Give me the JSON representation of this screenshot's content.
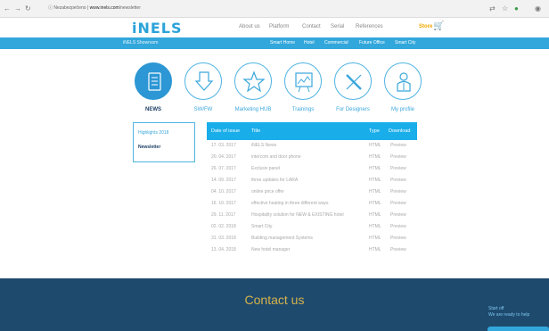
{
  "browser": {
    "url_prefix": "ⓘ Nezabezpečeno |",
    "url_host": "www.inels.com",
    "url_path": "/newsletter"
  },
  "header": {
    "logo": "iNELS",
    "nav": [
      "About us",
      "Platform",
      "Contact",
      "Serial",
      "References"
    ],
    "store_label": "Store"
  },
  "subbar": {
    "brand": "iNELS Showroom",
    "items": [
      "Smart Home",
      "Hotel",
      "Commercial",
      "Future Office",
      "Smart City"
    ]
  },
  "categories": [
    "NEWS",
    "SW/FW",
    "Marketing HUB",
    "Trainings",
    "For Designers",
    "My profile"
  ],
  "sidebar": {
    "items": [
      "Highlights 2018",
      "Newsletter"
    ]
  },
  "table": {
    "headers": [
      "Date of issue",
      "Title",
      "Type",
      "Download"
    ],
    "rows": [
      [
        "17. 03. 2017",
        "iNELS News",
        "HTML",
        "Preview"
      ],
      [
        "20. 04. 2017",
        "intercom and door phone",
        "HTML",
        "Preview"
      ],
      [
        "26. 07. 2017",
        "Exclusiv panel",
        "HTML",
        "Preview"
      ],
      [
        "14. 09. 2017",
        "three updates for LARA",
        "HTML",
        "Preview"
      ],
      [
        "04. 10. 2017",
        "online price offer",
        "HTML",
        "Preview"
      ],
      [
        "16. 10. 2017",
        "effective heating in three different ways",
        "HTML",
        "Preview"
      ],
      [
        "29. 11. 2017",
        "Hospitality solution for NEW & EXISTING hotel",
        "HTML",
        "Preview"
      ],
      [
        "02. 02. 2018",
        "Smart City",
        "HTML",
        "Preview"
      ],
      [
        "31. 03. 2018",
        "Building management Systems",
        "HTML",
        "Preview"
      ],
      [
        "13. 04. 2018",
        "New hotel manager",
        "HTML",
        "Preview"
      ]
    ]
  },
  "footer": {
    "title": "Contact us",
    "chat_line1": "Start off",
    "chat_line2": "We are ready to help"
  },
  "colors": {
    "accent": "#32a7dc",
    "table_header": "#19aeea",
    "footer": "#1e4a6e",
    "footer_title": "#d8b34a",
    "store": "#f2a800"
  }
}
